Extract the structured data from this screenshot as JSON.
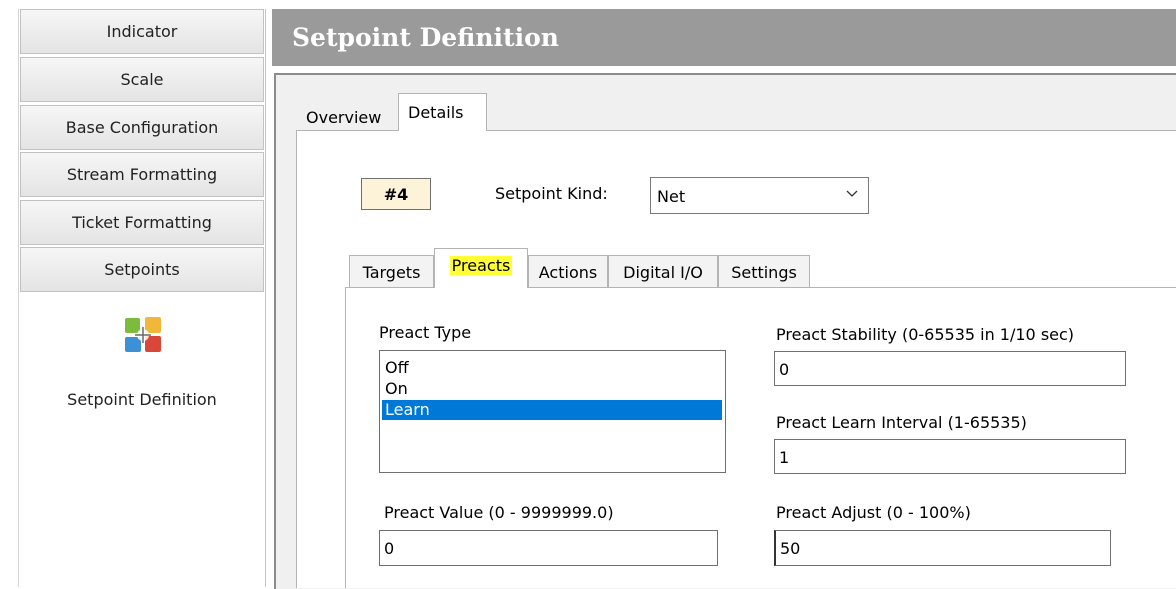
{
  "sidebar": {
    "items": [
      {
        "label": "Indicator"
      },
      {
        "label": "Scale"
      },
      {
        "label": "Base Configuration"
      },
      {
        "label": "Stream Formatting"
      },
      {
        "label": "Ticket Formatting"
      },
      {
        "label": "Setpoints"
      }
    ],
    "active_module": {
      "label": "Setpoint Definition",
      "icon": "setpoint-definition-icon"
    }
  },
  "header": {
    "title": "Setpoint Definition"
  },
  "tabs": [
    {
      "label": "Overview"
    },
    {
      "label": "Details"
    }
  ],
  "selected_tab": "Details",
  "details": {
    "setpoint_number": "#4",
    "setpoint_kind_label": "Setpoint Kind:",
    "setpoint_kind_value": "Net",
    "inner_tabs": [
      {
        "label": "Targets"
      },
      {
        "label": "Preacts"
      },
      {
        "label": "Actions"
      },
      {
        "label": "Digital I/O"
      },
      {
        "label": "Settings"
      }
    ],
    "selected_inner_tab": "Preacts",
    "preacts": {
      "preact_type_label": "Preact Type",
      "preact_type_options": [
        "Off",
        "On",
        "Learn"
      ],
      "preact_type_selected": "Learn",
      "preact_value_label": "Preact Value  (0 - 9999999.0)",
      "preact_value": "0",
      "stability_label": "Preact Stability  (0-65535 in 1/10 sec)",
      "stability_value": "0",
      "learn_interval_label": "Preact Learn Interval  (1-65535)",
      "learn_interval_value": "1",
      "adjust_label": "Preact Adjust  (0 - 100%)",
      "adjust_value": "50"
    }
  },
  "colors": {
    "header_bg": "#9a9a9a",
    "selection": "#0078d7",
    "highlight": "#ffff33",
    "number_badge_bg": "#fdf3d8"
  }
}
